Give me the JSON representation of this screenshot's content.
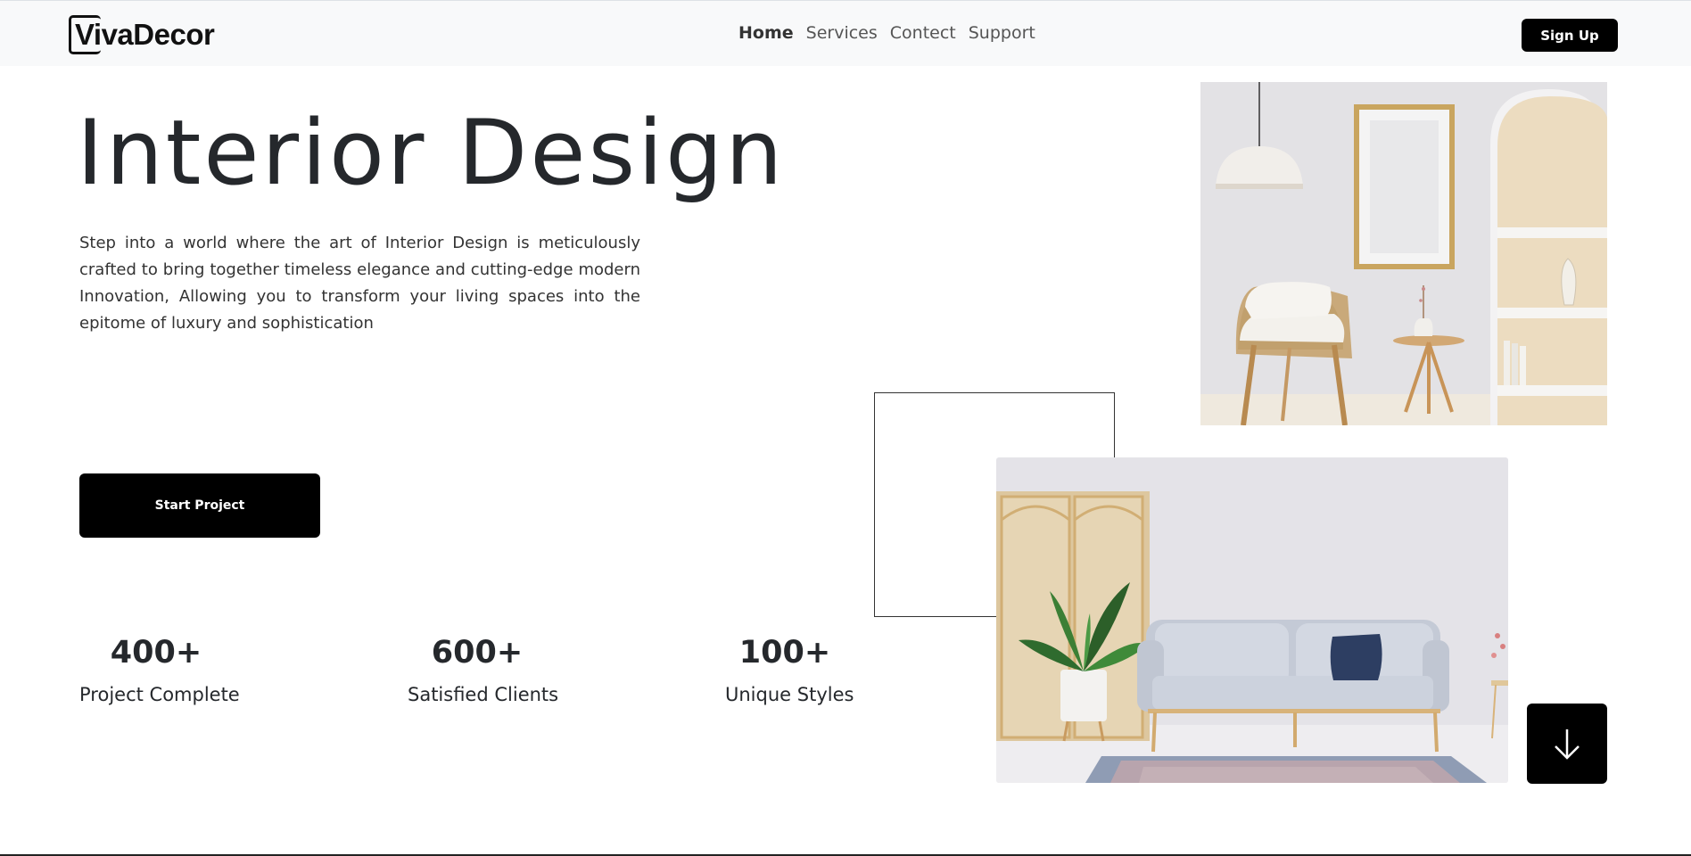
{
  "brand": {
    "name": "VivaDecor"
  },
  "nav": {
    "links": [
      {
        "label": "Home",
        "active": true
      },
      {
        "label": "Services",
        "active": false
      },
      {
        "label": "Contect",
        "active": false
      },
      {
        "label": "Support",
        "active": false
      }
    ],
    "signup_label": "Sign Up"
  },
  "hero": {
    "title": "Interior Design",
    "description": "Step into a world where the art of Interior Design is meticulously crafted to bring together timeless elegance and cutting-edge modern Innovation, Allowing you to transform your living spaces into the epitome of luxury and sophistication",
    "cta_label": "Start Project"
  },
  "stats": [
    {
      "value": "400+",
      "label": "Project Complete"
    },
    {
      "value": "600+",
      "label": "Satisfied Clients"
    },
    {
      "value": "100+",
      "label": "Unique Styles"
    }
  ],
  "icons": {
    "scroll_down": "arrow-down-icon"
  },
  "colors": {
    "navbar_bg": "#f8f9fa",
    "primary_button": "#000000",
    "text_dark": "#25282c"
  }
}
